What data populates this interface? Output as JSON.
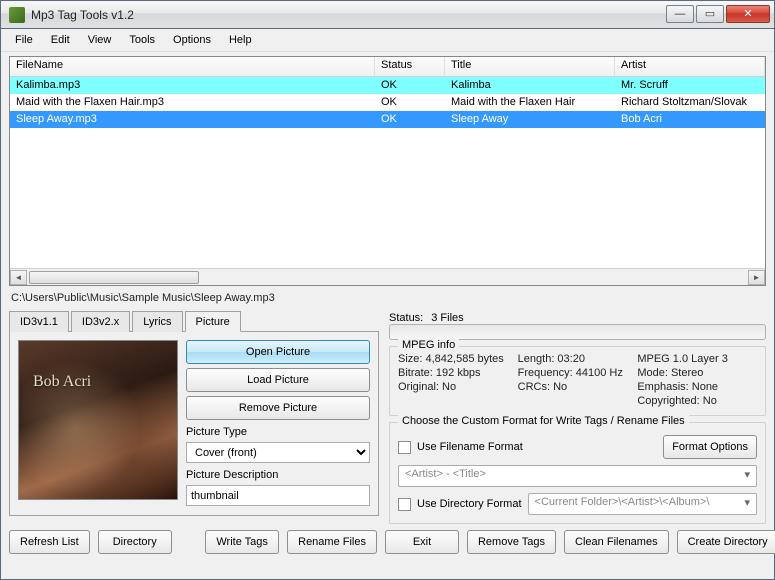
{
  "window": {
    "title": "Mp3 Tag Tools v1.2"
  },
  "menu": {
    "items": [
      "File",
      "Edit",
      "View",
      "Tools",
      "Options",
      "Help"
    ]
  },
  "columns": {
    "filename": "FileName",
    "status": "Status",
    "title": "Title",
    "artist": "Artist"
  },
  "rows": [
    {
      "filename": "Kalimba.mp3",
      "status": "OK",
      "title": "Kalimba",
      "artist": "Mr. Scruff",
      "state": "highlight"
    },
    {
      "filename": "Maid with the Flaxen Hair.mp3",
      "status": "OK",
      "title": "Maid with the Flaxen Hair",
      "artist": "Richard Stoltzman/Slovak",
      "state": ""
    },
    {
      "filename": "Sleep Away.mp3",
      "status": "OK",
      "title": "Sleep Away",
      "artist": "Bob Acri",
      "state": "selected"
    }
  ],
  "path": "C:\\Users\\Public\\Music\\Sample Music\\Sleep Away.mp3",
  "tabs": {
    "id3v11": "ID3v1.1",
    "id3v2x": "ID3v2.x",
    "lyrics": "Lyrics",
    "picture": "Picture"
  },
  "album_art": {
    "title": "Bob Acri",
    "subtitle": ""
  },
  "art_btns": {
    "open": "Open Picture",
    "load": "Load Picture",
    "remove": "Remove Picture"
  },
  "pic_type": {
    "label": "Picture Type",
    "value": "Cover (front)"
  },
  "pic_desc": {
    "label": "Picture Description",
    "value": "thumbnail"
  },
  "status": {
    "label": "Status:",
    "value": "3 Files"
  },
  "mpeg": {
    "legend": "MPEG info",
    "size": "Size: 4,842,585 bytes",
    "length": "Length:  03:20",
    "layer": "MPEG 1.0 Layer 3",
    "bitrate": "Bitrate: 192 kbps",
    "freq": "Frequency:  44100 Hz",
    "mode": "Mode:  Stereo",
    "original": "Original: No",
    "crc": "CRCs: No",
    "emphasis": "Emphasis:  None",
    "copyright": "Copyrighted: No"
  },
  "fmt": {
    "legend": "Choose the Custom Format for Write Tags / Rename Files",
    "use_filename": "Use Filename Format",
    "format_options": "Format Options",
    "filename_tpl": "<Artist> - <Title>",
    "use_directory": "Use Directory Format",
    "directory_tpl": "<Current Folder>\\<Artist>\\<Album>\\"
  },
  "buttons": {
    "refresh": "Refresh List",
    "directory": "Directory",
    "write": "Write Tags",
    "rename": "Rename Files",
    "exit": "Exit",
    "remove": "Remove Tags",
    "clean": "Clean Filenames",
    "create": "Create Directory"
  }
}
